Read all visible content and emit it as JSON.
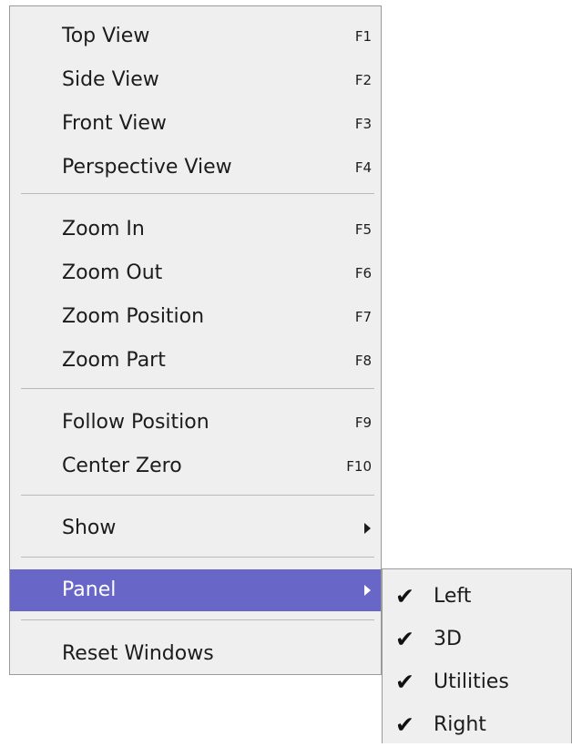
{
  "view_menu": {
    "items": [
      {
        "label": "Top View",
        "shortcut": "F1"
      },
      {
        "label": "Side View",
        "shortcut": "F2"
      },
      {
        "label": "Front View",
        "shortcut": "F3"
      },
      {
        "label": "Perspective View",
        "shortcut": "F4"
      },
      {
        "label": "Zoom In",
        "shortcut": "F5"
      },
      {
        "label": "Zoom Out",
        "shortcut": "F6"
      },
      {
        "label": "Zoom Position",
        "shortcut": "F7"
      },
      {
        "label": "Zoom Part",
        "shortcut": "F8"
      },
      {
        "label": "Follow Position",
        "shortcut": "F9"
      },
      {
        "label": "Center Zero",
        "shortcut": "F10"
      },
      {
        "label": "Show",
        "submenu_icon": "triangle-right-icon"
      },
      {
        "label": "Panel",
        "submenu_icon": "triangle-right-icon",
        "highlighted": true
      },
      {
        "label": "Reset Windows"
      }
    ]
  },
  "panel_submenu": {
    "check_glyph": "✔",
    "items": [
      {
        "label": "Left",
        "checked": true
      },
      {
        "label": "3D",
        "checked": true
      },
      {
        "label": "Utilities",
        "checked": true
      },
      {
        "label": "Right",
        "checked": true
      }
    ]
  },
  "colors": {
    "menu_background": "#efefef",
    "highlight": "#6866c6",
    "separator": "#b9b9b9"
  }
}
